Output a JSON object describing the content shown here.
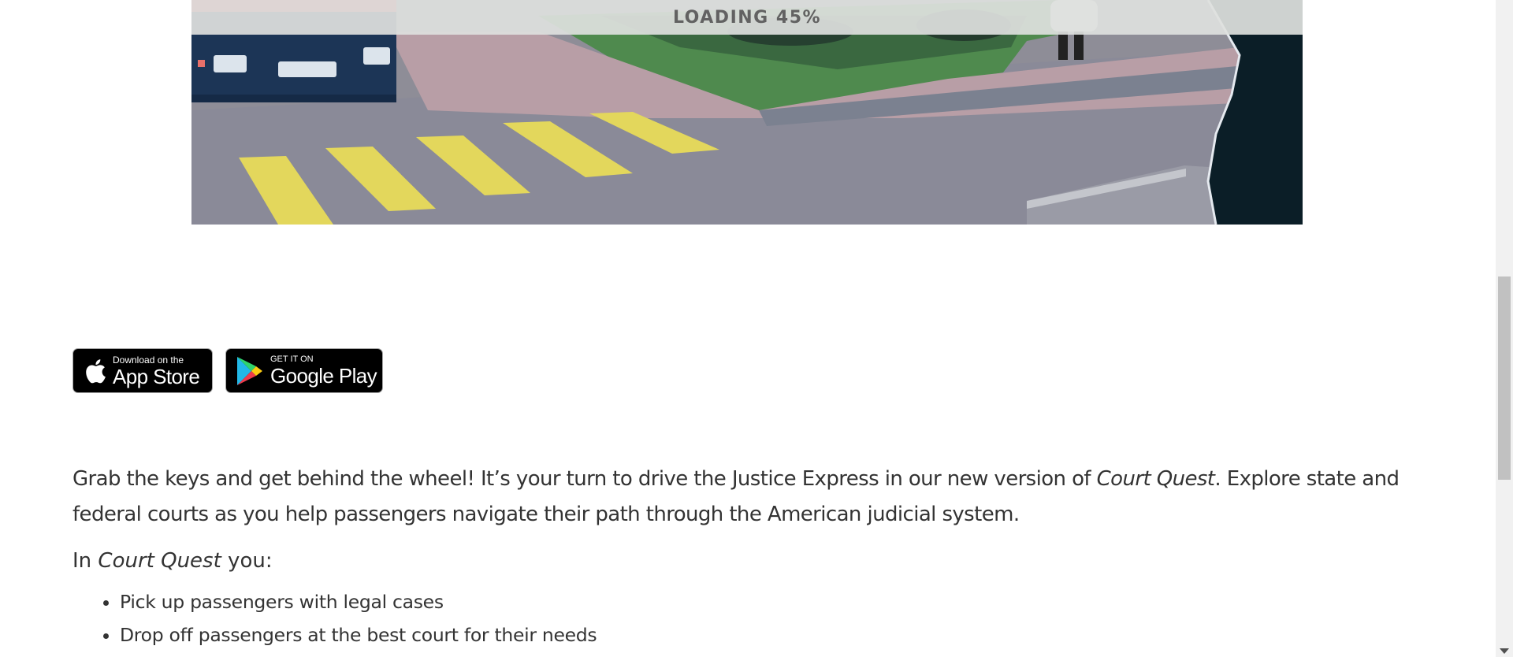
{
  "game": {
    "loading_label": "LOADING 45%",
    "loading_progress": 0.45
  },
  "badges": {
    "apple": {
      "small": "Download on the",
      "big": "App Store",
      "icon": "apple-icon"
    },
    "google": {
      "small": "GET IT ON",
      "big": "Google Play",
      "icon": "google-play-icon"
    }
  },
  "content": {
    "intro_part1": "Grab the keys and get behind the wheel! It’s your turn to drive the Justice Express in our new version of ",
    "intro_title": "Court Quest",
    "intro_part2": ". Explore state and federal courts as you help passengers navigate their path through the American judicial system.",
    "in_prefix": "In ",
    "in_title": "Court Quest",
    "in_suffix": " you:",
    "bullets": [
      "Pick up passengers with legal cases",
      "Drop off passengers at the best court for their needs"
    ]
  }
}
